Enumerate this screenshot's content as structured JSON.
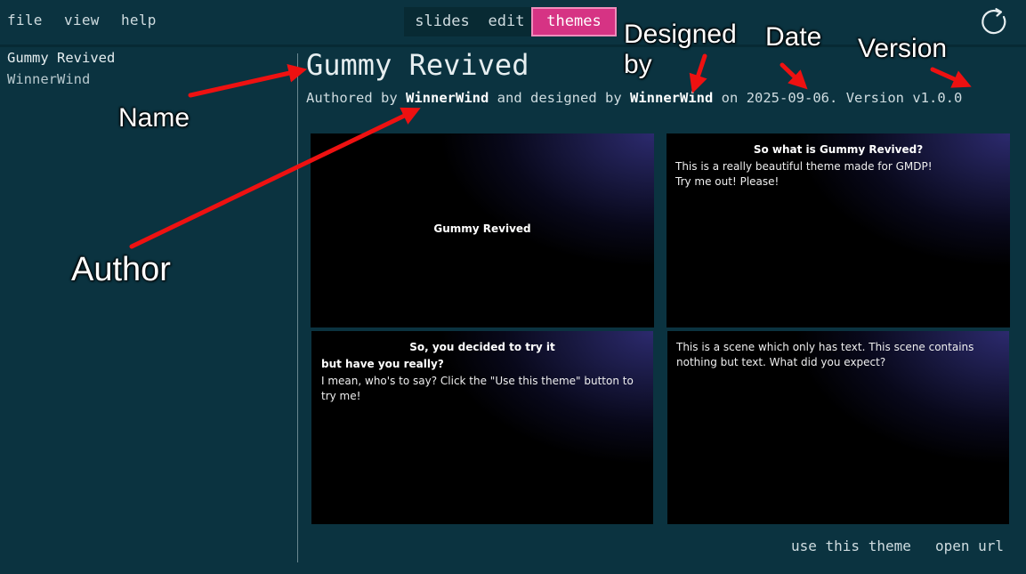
{
  "menu": {
    "file": "file",
    "view": "view",
    "help": "help"
  },
  "modes": {
    "slides": "slides",
    "edit": "edit",
    "themes": "themes",
    "active": "themes"
  },
  "sidebar": {
    "themes": [
      {
        "name": "Gummy Revived",
        "author": "WinnerWind"
      }
    ]
  },
  "theme": {
    "title": "Gummy Revived",
    "meta": {
      "authored_prefix": "Authored by",
      "author": "WinnerWind",
      "designed_prefix": "and designed by",
      "designer": "WinnerWind",
      "on_word": "on",
      "date": "2025-09-06.",
      "version_text": "Version v1.0.0"
    }
  },
  "slides": [
    {
      "title": "Gummy Revived"
    },
    {
      "heading": "So what is Gummy Revived?",
      "body": "This is a really beautiful theme made for GMDP!\nTry me out! Please!"
    },
    {
      "heading": "So, you decided to try it",
      "subheading": "but have you really?",
      "body": "I mean, who's to say? Click the \"Use this theme\" button to try me!"
    },
    {
      "body": "This is a scene which only has text. This scene contains nothing but text. What did you expect?"
    }
  ],
  "actions": {
    "use_theme": "use this theme",
    "open_url": "open url"
  },
  "annotations": {
    "designed_by": "Designed\nby",
    "date": "Date",
    "version": "Version",
    "name": "Name",
    "author": "Author"
  },
  "colors": {
    "background": "#0b3340",
    "active_tab": "#d63384",
    "annotation_arrow": "#ee1111"
  },
  "icons": {
    "refresh": "refresh-icon"
  }
}
